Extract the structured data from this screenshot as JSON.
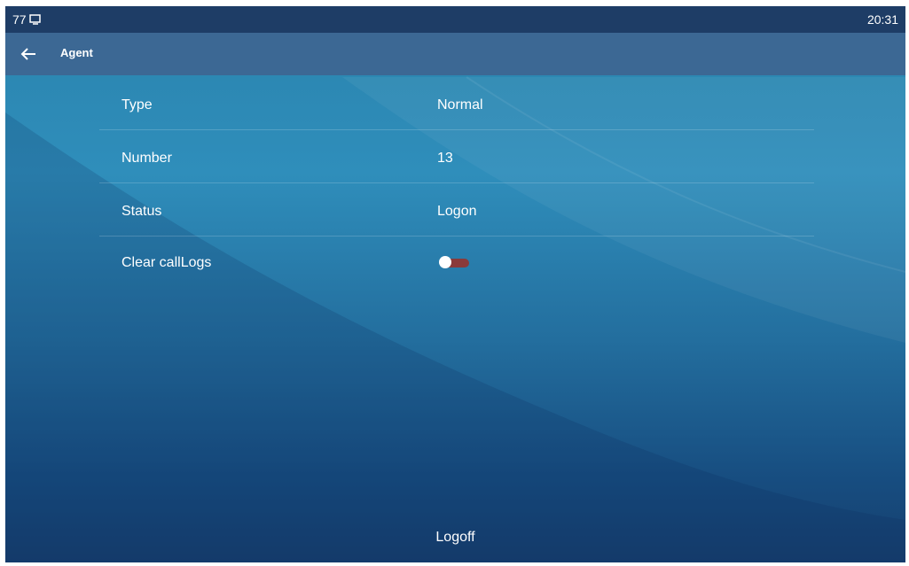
{
  "status_bar": {
    "left_text": "77",
    "time": "20:31"
  },
  "header": {
    "title": "Agent"
  },
  "rows": [
    {
      "label": "Type",
      "value": "Normal"
    },
    {
      "label": "Number",
      "value": "13"
    },
    {
      "label": "Status",
      "value": "Logon"
    },
    {
      "label": "Clear callLogs",
      "toggle_on": false
    }
  ],
  "footer": {
    "logoff_label": "Logoff"
  },
  "colors": {
    "status_bar_bg": "#1e3d66",
    "header_bg": "#3c6894",
    "toggle_track_off": "#8a3a3a"
  }
}
